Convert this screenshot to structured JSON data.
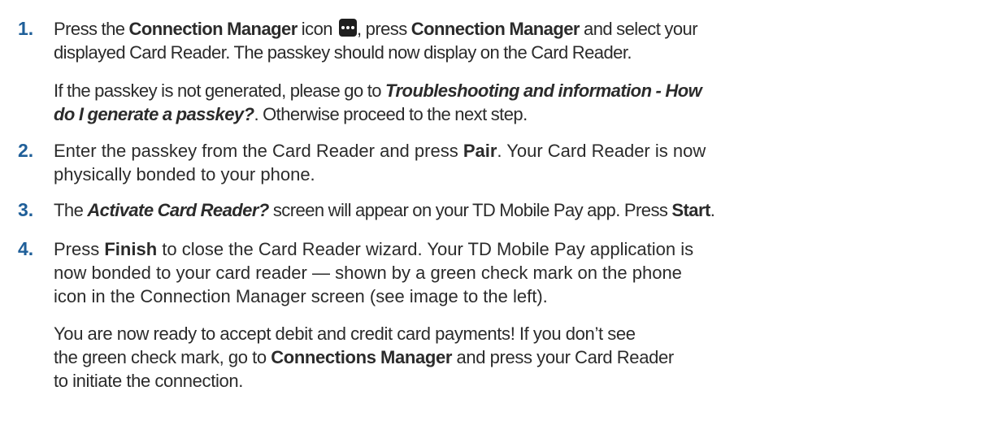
{
  "steps": [
    {
      "number": "1.",
      "line1": {
        "t1": "Press the ",
        "b1": "Connection Manager",
        "t2": " icon ",
        "icon": "more-dots-icon",
        "t3": ", press ",
        "b2": "Connection Manager",
        "t4": " and select your"
      },
      "line2": "displayed Card Reader. The passkey should now display on the Card Reader.",
      "note": {
        "t1": "If the passkey is not generated, please go to ",
        "bi1": "Troubleshooting and information - How",
        "bi2": "do I generate a passkey?",
        "t2": ". Otherwise proceed to the next step."
      }
    },
    {
      "number": "2.",
      "t1": "Enter the passkey from the Card Reader and press ",
      "b1": "Pair",
      "t2": ". Your Card Reader is now",
      "line2": "physically bonded to your phone."
    },
    {
      "number": "3.",
      "t1": "The ",
      "bi1": "Activate Card Reader?",
      "t2": " screen will appear on your TD Mobile Pay app. Press ",
      "b1": "Start",
      "t3": "."
    },
    {
      "number": "4.",
      "t1": "Press ",
      "b1": "Finish",
      "t2": " to close the Card Reader wizard. Your TD Mobile Pay application is",
      "line2": "now bonded to your card reader — shown by a green check mark on the phone",
      "line3": "icon in the Connection Manager screen (see image to the left).",
      "note": {
        "line1": "You are now ready to accept debit and credit card payments! If you don’t see",
        "t1": "the green check mark, go to ",
        "b1": "Connections Manager",
        "t2": " and press your Card Reader",
        "line3": "to initiate the connection."
      }
    }
  ]
}
